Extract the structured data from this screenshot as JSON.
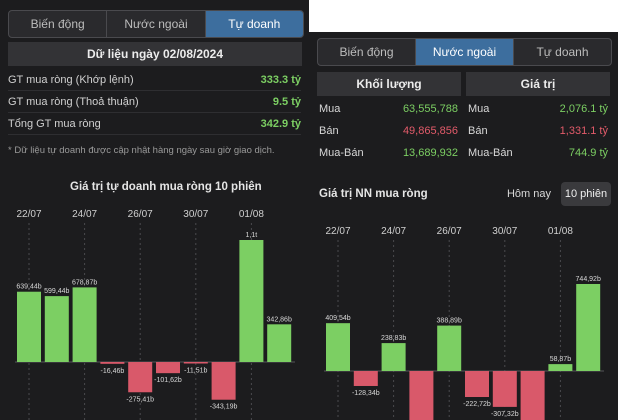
{
  "left": {
    "tabs": [
      {
        "label": "Biến động",
        "active": false
      },
      {
        "label": "Nước ngoài",
        "active": false
      },
      {
        "label": "Tự doanh",
        "active": true
      }
    ],
    "date_header": "Dữ liệu ngày 02/08/2024",
    "rows": [
      {
        "label": "GT mua ròng (Khớp lệnh)",
        "value": "333.3 tỷ"
      },
      {
        "label": "GT mua ròng (Thoả thuận)",
        "value": "9.5 tỷ"
      },
      {
        "label": "Tổng GT mua ròng",
        "value": "342.9 tỷ"
      }
    ],
    "note": "* Dữ liệu tự doanh được cập nhật hàng ngày sau giờ giao dịch."
  },
  "right": {
    "tabs": [
      {
        "label": "Biến động",
        "active": false
      },
      {
        "label": "Nước ngoài",
        "active": true
      },
      {
        "label": "Tự doanh",
        "active": false
      }
    ],
    "table": {
      "headers": [
        "Khối lượng",
        "Giá trị"
      ],
      "rows": [
        {
          "label": "Mua",
          "volume": "63,555,788",
          "value_label": "Mua",
          "value": "2,076.1 tỷ",
          "color": "green"
        },
        {
          "label": "Bán",
          "volume": "49,865,856",
          "value_label": "Bán",
          "value": "1,331.1 tỷ",
          "color": "red"
        },
        {
          "label": "Mua-Bán",
          "volume": "13,689,932",
          "value_label": "Mua-Bán",
          "value": "744.9 tỷ",
          "color": "green"
        }
      ]
    },
    "toggle": [
      "Hôm nay",
      "10 phiên"
    ],
    "toggle_selected": 1
  },
  "colors": {
    "positive": "#7ccf63",
    "negative": "#d9596a",
    "accent": "#3d6e9e",
    "background": "#1c1c1e"
  },
  "chart_data": [
    {
      "type": "bar",
      "title": "Giá trị tự doanh mua ròng 10 phiên",
      "date_labels": [
        "22/07",
        "24/07",
        "26/07",
        "30/07",
        "01/08"
      ],
      "values": [
        639.44,
        599.44,
        678.87,
        -16.46,
        -275.41,
        -101.62,
        -11.51,
        -343.19,
        1110,
        342.86
      ],
      "value_labels": [
        "639,44b",
        "599,44b",
        "678,87b",
        "-16,46b",
        "-275,41b",
        "-101,62b",
        "-11,51b",
        "-343,19b",
        "1,1t",
        "342,86b"
      ]
    },
    {
      "type": "bar",
      "title": "Giá trị NN mua ròng",
      "date_labels": [
        "22/07",
        "24/07",
        "26/07",
        "30/07",
        "01/08"
      ],
      "values": [
        409.54,
        -128.34,
        238.83,
        -489.35,
        388.89,
        -222.72,
        -307.32,
        -600,
        58.87,
        744.92
      ],
      "value_labels": [
        "409,54b",
        "-128,34b",
        "238,83b",
        "-489,35b",
        "388,89b",
        "-222,72b",
        "-307,32b",
        "",
        "58,87b",
        "744,92b"
      ]
    }
  ]
}
